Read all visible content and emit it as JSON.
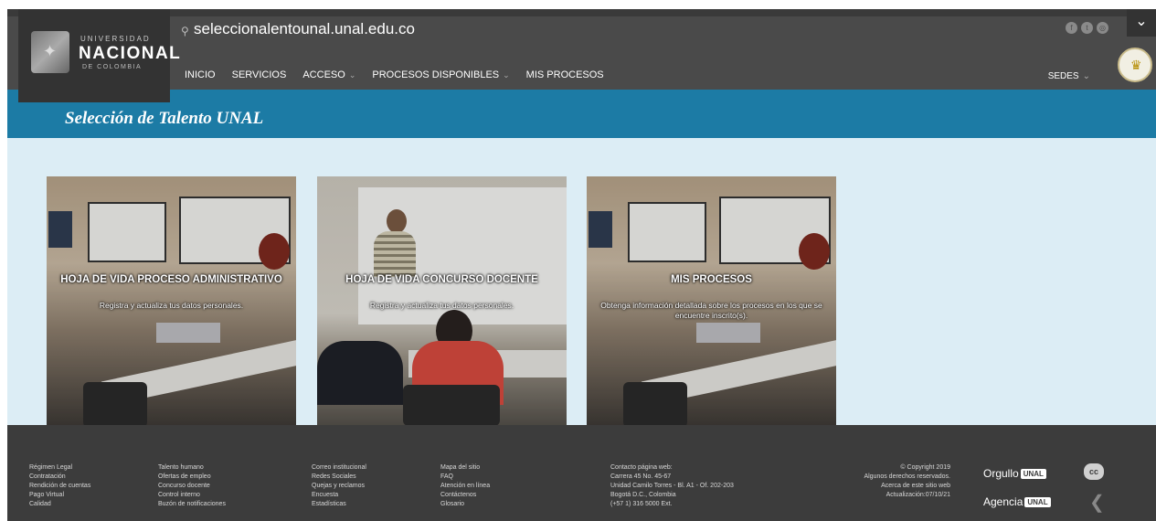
{
  "header": {
    "logo": {
      "line1": "UNIVERSIDAD",
      "line2": "NACIONAL",
      "line3": "DE COLOMBIA"
    },
    "site_url": "seleccionalentounal.unal.edu.co",
    "nav": [
      {
        "label": "INICIO",
        "dropdown": false
      },
      {
        "label": "SERVICIOS",
        "dropdown": false
      },
      {
        "label": "ACCESO",
        "dropdown": true
      },
      {
        "label": "PROCESOS DISPONIBLES",
        "dropdown": true
      },
      {
        "label": "MIS PROCESOS",
        "dropdown": false
      }
    ],
    "sedes_label": "SEDES",
    "social_icons": [
      "facebook-icon",
      "twitter-icon",
      "instagram-icon"
    ],
    "colors": {
      "topbar": "#4a4a4a",
      "bluebar": "#1c7ba5",
      "background": "#dcedf5"
    }
  },
  "page_title": "Selección de Talento UNAL",
  "tiles": [
    {
      "title": "HOJA DE VIDA PROCESO ADMINISTRATIVO",
      "subtitle": "Registra y actualiza tus datos personales."
    },
    {
      "title": "HOJA DE VIDA CONCURSO DOCENTE",
      "subtitle": "Registra y actualiza tus datos personales."
    },
    {
      "title": "MIS PROCESOS",
      "subtitle": "Obtenga información detallada sobre los procesos en los que se encuentre inscrito(s)."
    }
  ],
  "footer": {
    "col1": [
      "Régimen Legal",
      "Contratación",
      "Rendición de cuentas",
      "Pago Virtual",
      "Calidad"
    ],
    "col2": [
      "Talento humano",
      "Ofertas de empleo",
      "Concurso docente",
      "Control interno",
      "Buzón de notificaciones"
    ],
    "col3": [
      "Correo institucional",
      "Redes Sociales",
      "Quejas y reclamos",
      "Encuesta",
      "Estadísticas"
    ],
    "col4": [
      "Mapa del sitio",
      "FAQ",
      "Atención en línea",
      "Contáctenos",
      "Glosario"
    ],
    "contact": [
      "Contacto página web:",
      "Carrera 45 No. 45-67",
      "Unidad Camilo Torres - Bl. A1 - Of. 202-203",
      "Bogotá D.C., Colombia",
      "(+57 1) 316 5000 Ext."
    ],
    "copyright": [
      "© Copyright 2019",
      "Algunos derechos reservados.",
      "Acerca de este sitio web",
      "Actualización:07/10/21"
    ],
    "orgullo": "Orgullo",
    "agencia": "Agencia",
    "unal_badge": "UNAL"
  }
}
